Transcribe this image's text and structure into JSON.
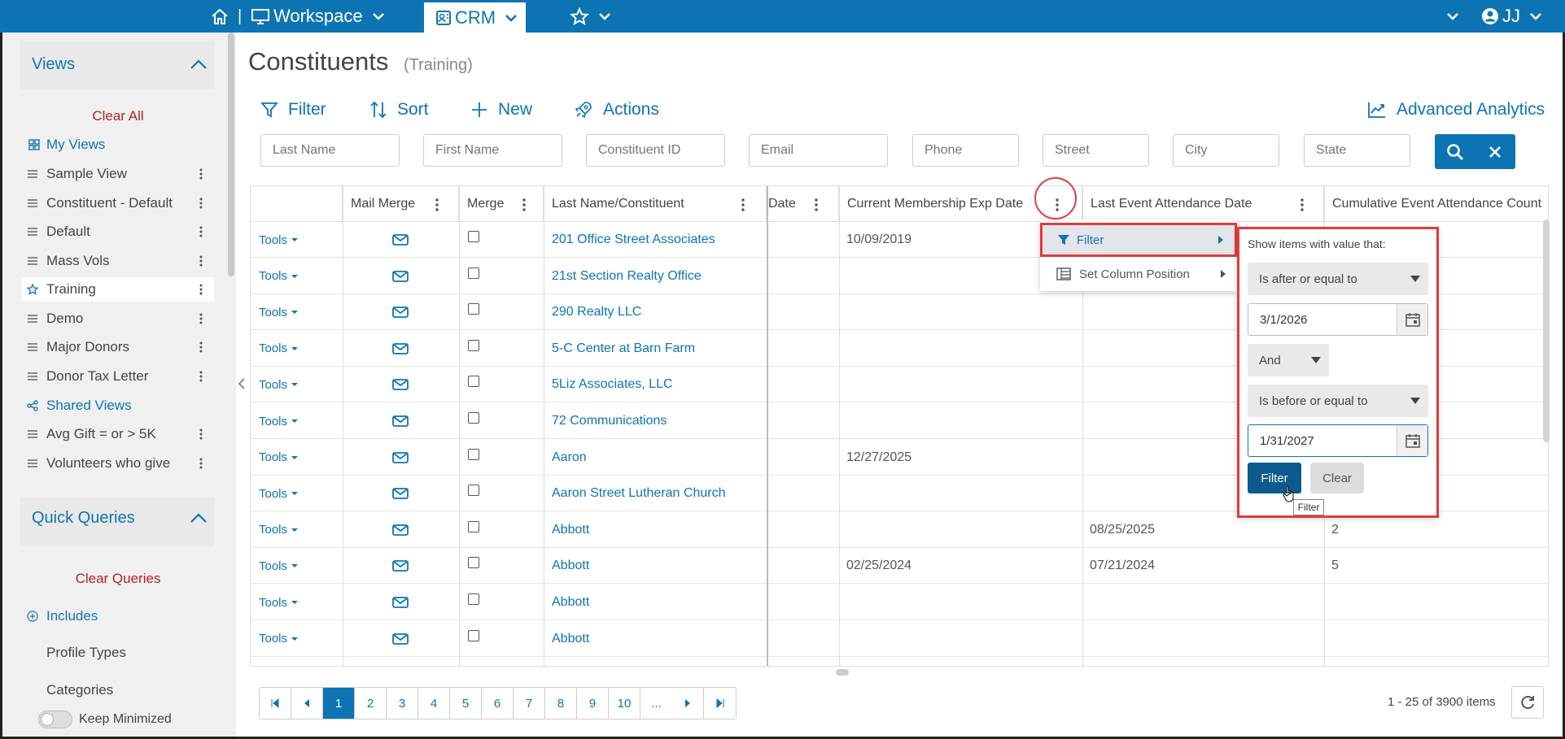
{
  "topbar": {
    "home_sep": "|",
    "workspace_label": "Workspace",
    "crm_label": "CRM",
    "user_initials": "JJ"
  },
  "sidebar": {
    "views_heading": "Views",
    "clear_all": "Clear All",
    "my_views": "My Views",
    "views": [
      {
        "label": "Sample View"
      },
      {
        "label": "Constituent - Default"
      },
      {
        "label": "Default"
      },
      {
        "label": "Mass Vols"
      },
      {
        "label": "Training"
      },
      {
        "label": "Demo"
      },
      {
        "label": "Major Donors"
      },
      {
        "label": "Donor Tax Letter"
      }
    ],
    "shared_views": "Shared Views",
    "shared": [
      {
        "label": "Avg Gift = or > 5K"
      },
      {
        "label": "Volunteers who give"
      }
    ],
    "quick_queries_heading": "Quick Queries",
    "clear_queries": "Clear Queries",
    "includes": "Includes",
    "profile_types": "Profile Types",
    "categories": "Categories",
    "keep_minimized": "Keep Minimized"
  },
  "page": {
    "title": "Constituents",
    "subtitle": "(Training)"
  },
  "toolbar": {
    "filter": "Filter",
    "sort": "Sort",
    "new": "New",
    "actions": "Actions",
    "advanced_analytics": "Advanced Analytics"
  },
  "search_fields": {
    "last_name": "Last Name",
    "first_name": "First Name",
    "constituent_id": "Constituent ID",
    "email": "Email",
    "phone": "Phone",
    "street": "Street",
    "city": "City",
    "state": "State"
  },
  "grid": {
    "headers": {
      "mail_merge": "Mail Merge",
      "merge": "Merge",
      "last_name": "Last Name/Constituent",
      "date_partial": "Date",
      "membership_exp": "Current Membership Exp Date",
      "last_event": "Last Event Attendance Date",
      "cumulative": "Cumulative Event Attendance Count"
    },
    "tools_label": "Tools",
    "rows": [
      {
        "name": "201 Office Street Associates",
        "exp": "10/09/2019",
        "event": "",
        "count": ""
      },
      {
        "name": "21st Section Realty Office",
        "exp": "",
        "event": "",
        "count": ""
      },
      {
        "name": "290 Realty LLC",
        "exp": "",
        "event": "",
        "count": ""
      },
      {
        "name": "5-C Center at Barn Farm",
        "exp": "",
        "event": "",
        "count": ""
      },
      {
        "name": "5Liz Associates, LLC",
        "exp": "",
        "event": "",
        "count": ""
      },
      {
        "name": "72 Communications",
        "exp": "",
        "event": "",
        "count": ""
      },
      {
        "name": "Aaron",
        "exp": "12/27/2025",
        "event": "",
        "count": ""
      },
      {
        "name": "Aaron Street Lutheran Church",
        "exp": "",
        "event": "",
        "count": ""
      },
      {
        "name": "Abbott",
        "exp": "",
        "event": "08/25/2025",
        "count": "2"
      },
      {
        "name": "Abbott",
        "exp": "02/25/2024",
        "event": "07/21/2024",
        "count": "5"
      },
      {
        "name": "Abbott",
        "exp": "",
        "event": "",
        "count": ""
      },
      {
        "name": "Abbott",
        "exp": "",
        "event": "",
        "count": ""
      }
    ]
  },
  "column_menu": {
    "filter": "Filter",
    "set_position": "Set Column Position"
  },
  "filter_panel": {
    "label": "Show items with value that:",
    "op1": "Is after or equal to",
    "val1": "3/1/2026",
    "logic": "And",
    "op2": "Is before or equal to",
    "val2": "1/31/2027",
    "filter_btn": "Filter",
    "clear_btn": "Clear",
    "tooltip": "Filter"
  },
  "pager": {
    "pages": [
      "1",
      "2",
      "3",
      "4",
      "5",
      "6",
      "7",
      "8",
      "9",
      "10",
      "..."
    ],
    "current": "1",
    "items_text": "1 - 25 of 3900 items"
  },
  "colors": {
    "primary": "#0d74b3",
    "highlight": "#e23b3b",
    "clear_red": "#b22222"
  }
}
